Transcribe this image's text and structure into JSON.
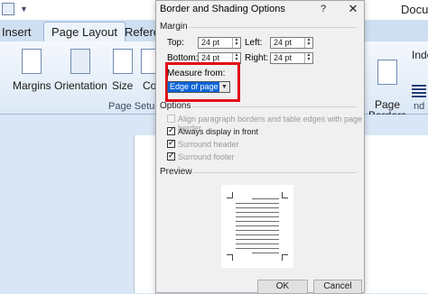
{
  "app": {
    "doc_title": "Docu",
    "tabs": [
      {
        "label": "Insert"
      },
      {
        "label": "Page Layout"
      },
      {
        "label": "Refere"
      }
    ],
    "ribbon": {
      "buttons": [
        {
          "label": "Margins"
        },
        {
          "label": "Orientation"
        },
        {
          "label": "Size"
        },
        {
          "label": "Col"
        },
        {
          "label": "Page\nBorders"
        }
      ],
      "group_page_setup": "Page Setup",
      "right_group_partial_label": "Inde",
      "right_group_partial_label2": "nd"
    }
  },
  "dialog": {
    "title": "Border and Shading Options",
    "help": "?",
    "close": "✕",
    "margin": {
      "heading": "Margin",
      "top_label": "Top:",
      "top_value": "24 pt",
      "left_label": "Left:",
      "left_value": "24 pt",
      "bottom_label": "Bottom:",
      "bottom_value": "24 pt",
      "right_label": "Right:",
      "right_value": "24 pt"
    },
    "measure_from": {
      "label": "Measure from:",
      "value": "Edge of page"
    },
    "options": {
      "heading": "Options",
      "items": [
        {
          "label": "Align paragraph borders and table edges with page border",
          "checked": false,
          "enabled": false
        },
        {
          "label": "Always display in front",
          "checked": true,
          "enabled": true
        },
        {
          "label": "Surround header",
          "checked": true,
          "enabled": false
        },
        {
          "label": "Surround footer",
          "checked": true,
          "enabled": false
        }
      ]
    },
    "preview": {
      "heading": "Preview"
    },
    "buttons": {
      "ok": "OK",
      "cancel": "Cancel"
    }
  },
  "colors": {
    "highlight_border": "#e30b17",
    "combo_selected": "#0a64d8"
  }
}
